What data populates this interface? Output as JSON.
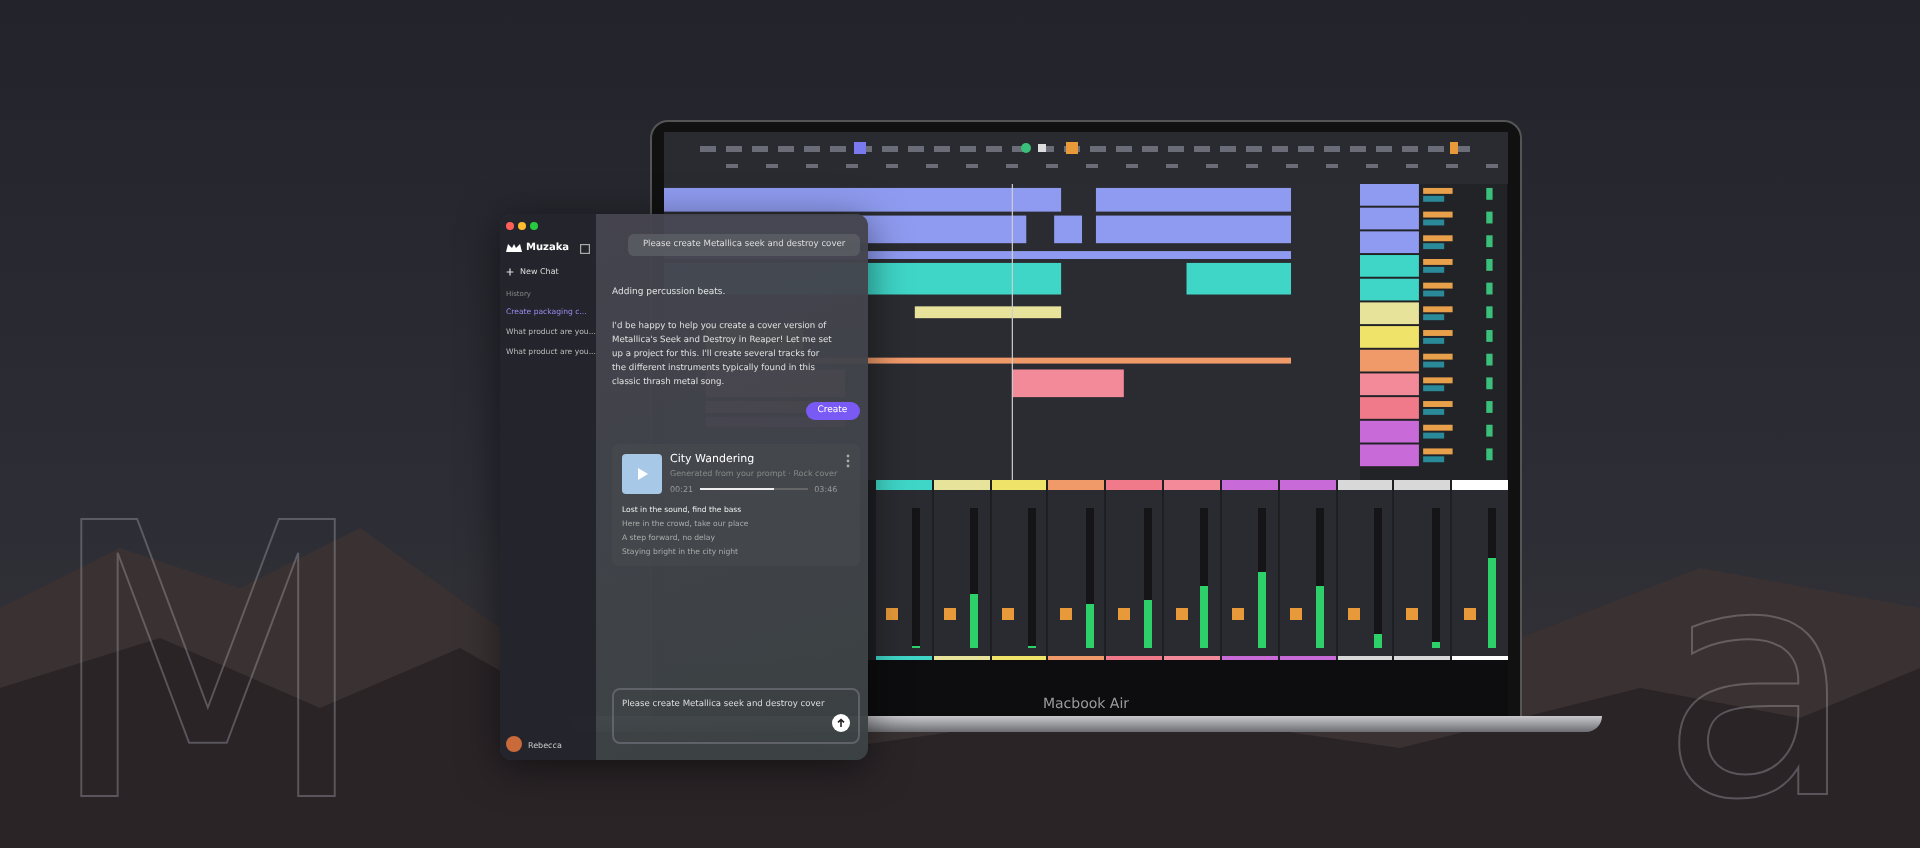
{
  "backdrop_letters": [
    "M",
    "a"
  ],
  "chat": {
    "app_name": "Muzaka",
    "new_chat": "New Chat",
    "history_label": "History",
    "history": [
      {
        "label": "Create packaging c...",
        "selected": true
      },
      {
        "label": "What product are you...",
        "selected": false
      },
      {
        "label": "What product are you...",
        "selected": false
      }
    ],
    "user_name": "Rebecca",
    "user_message": "Please create Metallica seek and destroy cover",
    "status": "Adding percussion beats.",
    "reply": "I'd be happy to help you create a cover version of Metallica's Seek and Destroy in Reaper! Let me set up a project for this. I'll create several tracks for the different instruments typically found in this classic thrash metal song.",
    "create_button": "Create",
    "song": {
      "title": "City Wandering",
      "subtitle": "Generated from your prompt · Rock cover",
      "elapsed": "00:21",
      "total": "03:46",
      "level": 0.68,
      "lyrics": [
        "Lost in the sound, find the bass",
        "Here in the crowd, take our place",
        "A step forward, no delay",
        "Staying bright in the city night"
      ]
    },
    "input": "Please create Metallica seek and destroy cover"
  },
  "laptop": {
    "label": "Macbook Air",
    "mixer": [
      {
        "color": "#3fd6c8",
        "level": 0.02
      },
      {
        "color": "#e8e39a",
        "level": 0.38
      },
      {
        "color": "#f0e36a",
        "level": 0.02
      },
      {
        "color": "#f09a6a",
        "level": 0.32
      },
      {
        "color": "#f07a8a",
        "level": 0.35
      },
      {
        "color": "#f28a9a",
        "level": 0.45
      },
      {
        "color": "#c86ad8",
        "level": 0.55
      },
      {
        "color": "#c86ad8",
        "level": 0.45
      },
      {
        "color": "#d8d8d8",
        "level": 0.1
      },
      {
        "color": "#d8d8d8",
        "level": 0.04
      },
      {
        "color": "#ffffff",
        "level": 0.65
      }
    ]
  }
}
